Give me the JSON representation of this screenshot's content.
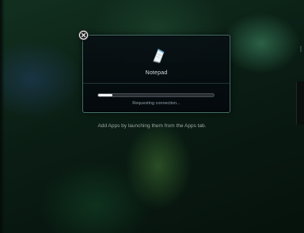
{
  "dialog": {
    "app_name": "Notepad",
    "status": "Requesting connection...",
    "progress": 0.12,
    "icon": "notepad-icon",
    "close_icon": "close-icon"
  },
  "hint": "Add Apps by launching them from the Apps tab."
}
